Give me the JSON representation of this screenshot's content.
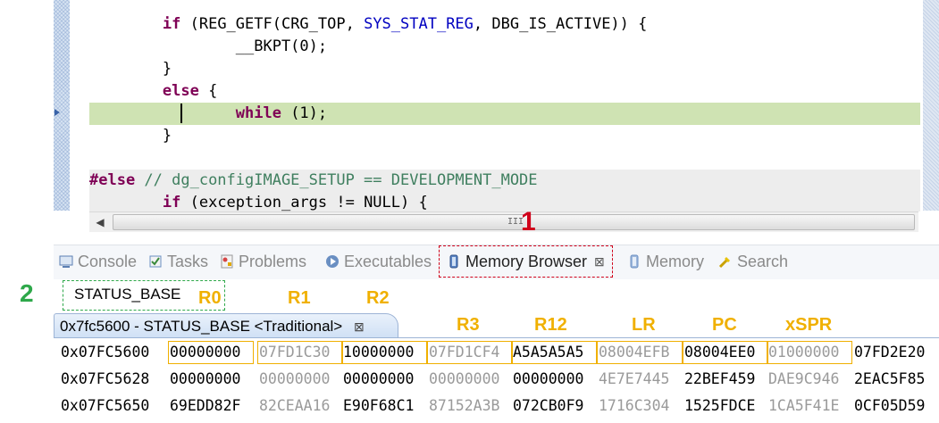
{
  "editor": {
    "lines": [
      {
        "indent": "        ",
        "parts": [
          {
            "t": "if",
            "c": "kw"
          },
          {
            "t": " (REG_GETF(CRG_TOP, ",
            "c": ""
          },
          {
            "t": "SYS_STAT_REG",
            "c": "mac"
          },
          {
            "t": ", DBG_IS_ACTIVE)) {",
            "c": ""
          }
        ]
      },
      {
        "indent": "                ",
        "parts": [
          {
            "t": "__BKPT(0);",
            "c": ""
          }
        ]
      },
      {
        "indent": "        ",
        "parts": [
          {
            "t": "}",
            "c": ""
          }
        ]
      },
      {
        "indent": "        ",
        "parts": [
          {
            "t": "else",
            "c": "kw"
          },
          {
            "t": " {",
            "c": ""
          }
        ]
      },
      {
        "indent": "                ",
        "parts": [
          {
            "t": "while",
            "c": "kw"
          },
          {
            "t": " (1);",
            "c": ""
          }
        ]
      },
      {
        "indent": "        ",
        "parts": [
          {
            "t": "}",
            "c": ""
          }
        ]
      },
      {
        "indent": "",
        "parts": [
          {
            "t": "",
            "c": ""
          }
        ]
      },
      {
        "indent": "",
        "parts": [
          {
            "t": "#else",
            "c": "kw"
          },
          {
            "t": " // dg_configIMAGE_SETUP == DEVELOPMENT_MODE",
            "c": "cmt"
          }
        ]
      },
      {
        "indent": "        ",
        "parts": [
          {
            "t": "if",
            "c": "kw"
          },
          {
            "t": " (exception_args != NULL) {",
            "c": ""
          }
        ]
      }
    ],
    "scroll_left": "◀",
    "scroll_grip": "III"
  },
  "annotations": {
    "one": "1",
    "two": "2",
    "registers": [
      "R0",
      "R1",
      "R2",
      "R3",
      "R12",
      "LR",
      "PC",
      "xSPR"
    ]
  },
  "tabs": [
    {
      "name": "console",
      "label": "Console",
      "icon": "console-icon",
      "active": false
    },
    {
      "name": "tasks",
      "label": "Tasks",
      "icon": "tasks-icon",
      "active": false
    },
    {
      "name": "problems",
      "label": "Problems",
      "icon": "problems-icon",
      "active": false
    },
    {
      "name": "executables",
      "label": "Executables",
      "icon": "executables-icon",
      "active": false
    },
    {
      "name": "memory-browser",
      "label": "Memory Browser",
      "icon": "memory-icon",
      "active": true,
      "close": "⊠"
    },
    {
      "name": "memory",
      "label": "Memory",
      "icon": "memory-icon",
      "active": false
    },
    {
      "name": "search",
      "label": "Search",
      "icon": "search-icon",
      "active": false
    }
  ],
  "memory_browser": {
    "address_input": "STATUS_BASE",
    "rendering_tab": "0x7fc5600 - STATUS_BASE <Traditional>",
    "rendering_close": "⊠",
    "rows": [
      {
        "addr": "0x07FC5600",
        "cells": [
          "00000000",
          "07FD1C30",
          "10000000",
          "07FD1CF4",
          "A5A5A5A5",
          "08004EFB",
          "08004EE0",
          "01000000",
          "07FD2E20"
        ]
      },
      {
        "addr": "0x07FC5628",
        "cells": [
          "00000000",
          "00000000",
          "00000000",
          "00000000",
          "00000000",
          "4E7E7445",
          "22BEF459",
          "DAE9C946",
          "2EAC5F85"
        ]
      },
      {
        "addr": "0x07FC5650",
        "cells": [
          "69EDD82F",
          "82CEAA16",
          "E90F68C1",
          "87152A3B",
          "072CB0F9",
          "1716C304",
          "1525FDCE",
          "1CA5F41E",
          "0CF05D59"
        ]
      }
    ]
  },
  "colors": {
    "keyword": "#7f0055",
    "macro": "#0000c0",
    "comment": "#3f7f5f",
    "current_line": "#cfe3b3",
    "annotation_red": "#d0021b",
    "annotation_green": "#2ea84a",
    "annotation_orange": "#f0b000"
  }
}
